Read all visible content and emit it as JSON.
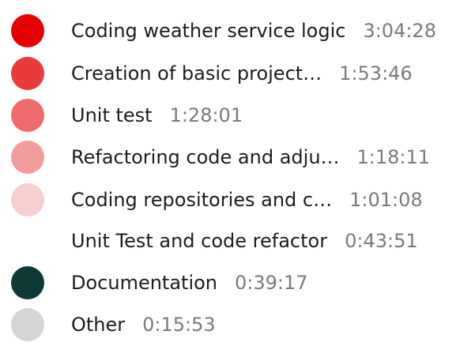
{
  "legend": {
    "items": [
      {
        "label": "Coding weather service logic",
        "duration": "3:04:28",
        "color": "#e60000"
      },
      {
        "label": "Creation of basic project…",
        "duration": "1:53:46",
        "color": "#ea3a3a"
      },
      {
        "label": "Unit test",
        "duration": "1:28:01",
        "color": "#ef6b6b"
      },
      {
        "label": "Refactoring code and adju…",
        "duration": "1:18:11",
        "color": "#f39c9c"
      },
      {
        "label": "Coding repositories and c…",
        "duration": "1:01:08",
        "color": "#f8cfd0"
      },
      {
        "label": "Unit Test and code refactor",
        "duration": "0:43:51",
        "color": "#ffffff"
      },
      {
        "label": "Documentation",
        "duration": "0:39:17",
        "color": "#0d3a35"
      },
      {
        "label": "Other",
        "duration": "0:15:53",
        "color": "#d5d5d5"
      }
    ]
  }
}
